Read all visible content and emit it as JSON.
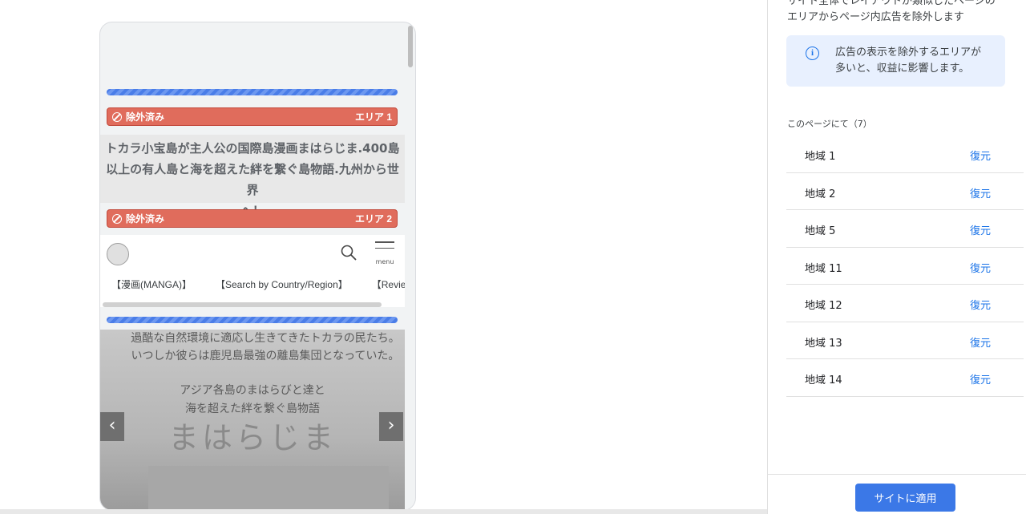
{
  "preview": {
    "excluded_label": "除外済み",
    "area1_label": "エリア 1",
    "area2_label": "エリア 2",
    "headline_lines": [
      "トカラ小宝島が主人公の国際島漫画まはらじま.400島",
      "以上の有人島と海を超えた絆を繋ぐ島物語.九州から世界",
      "へ！"
    ],
    "menu_label": "menu",
    "nav_items": [
      "【漫画(MANGA)】",
      "【Search by Country/Region】",
      "【Review"
    ],
    "hero": {
      "line1": "過酷な自然環境に適応し生きてきたトカラの民たち。",
      "line2": "いつしか彼らは鹿児島最強の離島集団となっていた。",
      "line3": "アジア各島のまはらびと達と",
      "line4": "海を超えた絆を繋ぐ島物語",
      "title": "まはらじま",
      "prev": "‹",
      "next": "›"
    }
  },
  "panel": {
    "top_text_line1": "サイト全体でレイアウトが類似したページの",
    "top_text_line2": "エリアからページ内広告を除外します",
    "info_line1": "広告の表示を除外するエリアが",
    "info_line2": "多いと、収益に影響します。",
    "list_heading": "このページにて（7）",
    "restore_label": "復元",
    "items": [
      {
        "name": "地域 1"
      },
      {
        "name": "地域 2"
      },
      {
        "name": "地域 5"
      },
      {
        "name": "地域 11"
      },
      {
        "name": "地域 12"
      },
      {
        "name": "地域 13"
      },
      {
        "name": "地域 14"
      }
    ],
    "apply_button": "サイトに適用"
  },
  "colors": {
    "accent": "#1a73e8",
    "excluded": "#e06c5c",
    "info_bg": "#e8f0fe"
  }
}
